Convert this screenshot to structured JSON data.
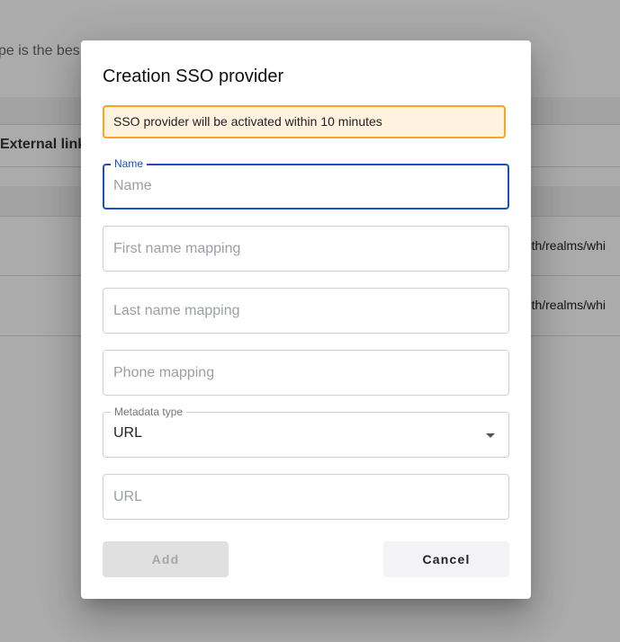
{
  "background": {
    "intro_text": "pe is the bes",
    "column_header": "External link",
    "row_url_1": "auth/realms/whi",
    "row_url_2": "auth/realms/whi"
  },
  "dialog": {
    "title": "Creation SSO provider",
    "alert_text": "SSO provider will be activated within 10 minutes",
    "fields": {
      "name": {
        "label": "Name",
        "placeholder": "Name",
        "value": ""
      },
      "first_name_mapping": {
        "placeholder": "First name mapping",
        "value": ""
      },
      "last_name_mapping": {
        "placeholder": "Last name mapping",
        "value": ""
      },
      "phone_mapping": {
        "placeholder": "Phone mapping",
        "value": ""
      },
      "metadata_type": {
        "label": "Metadata type",
        "selected": "URL"
      },
      "url": {
        "placeholder": "URL",
        "value": ""
      }
    },
    "buttons": {
      "add": "Add",
      "cancel": "Cancel"
    }
  },
  "colors": {
    "primary": "#1a4fc2",
    "alert_background": "#fff3e0",
    "alert_border": "#f5a623",
    "disabled_button": "#e0e0e0"
  }
}
